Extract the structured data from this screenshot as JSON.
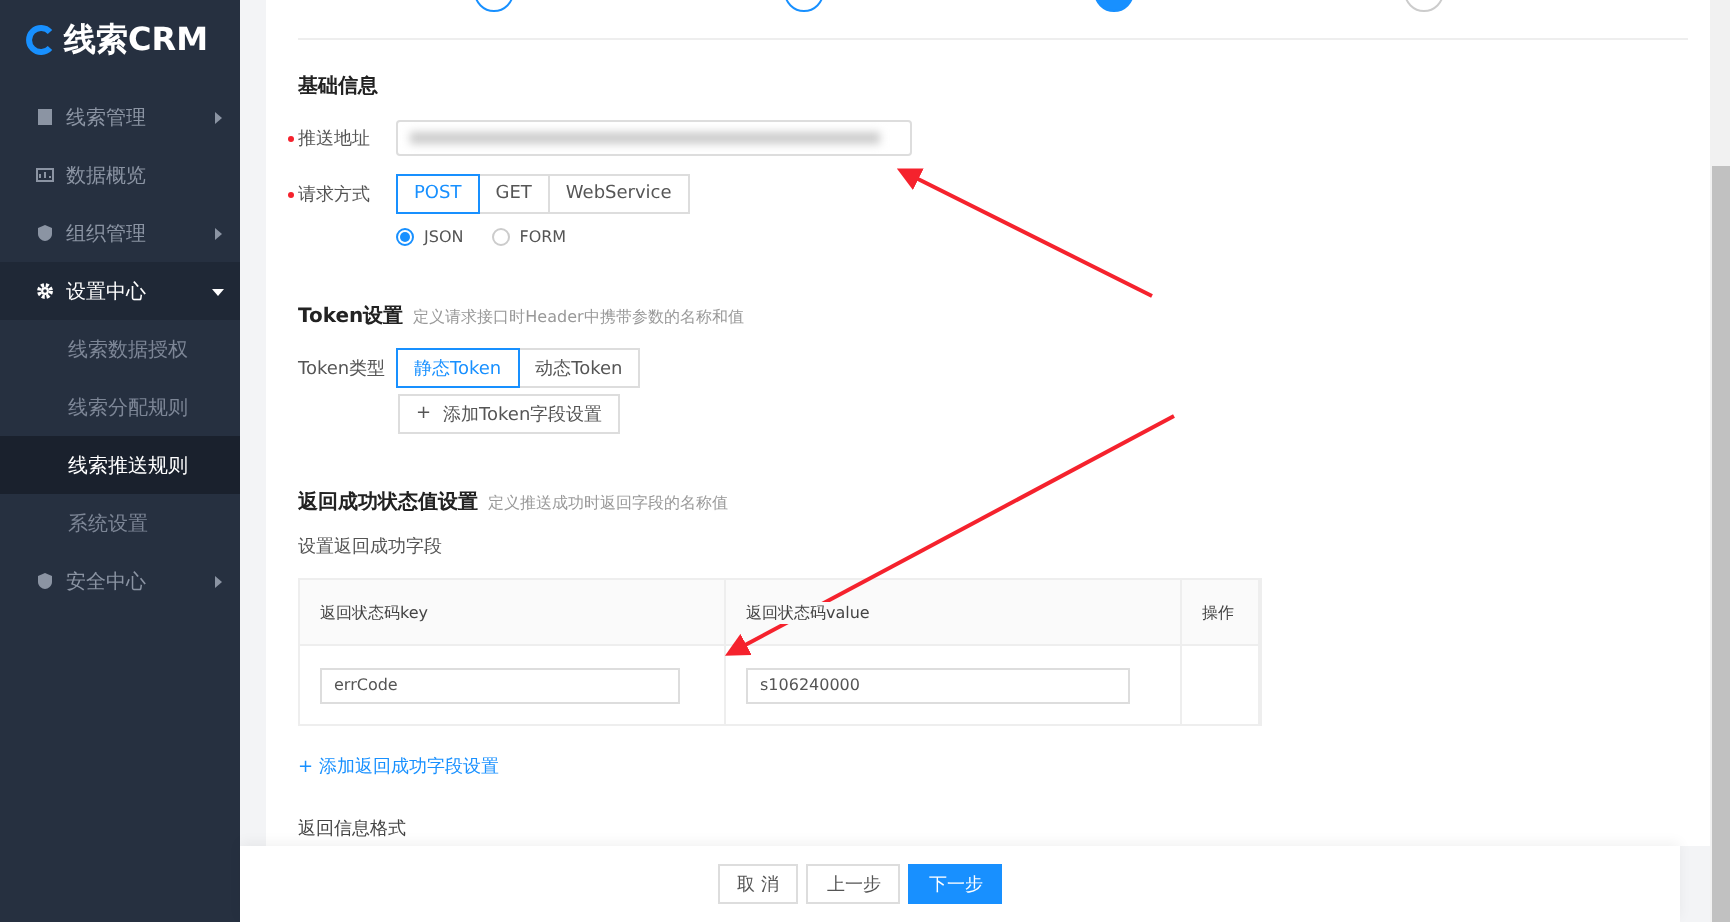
{
  "logo": {
    "text": "线索CRM"
  },
  "sidebar": {
    "items": [
      {
        "label": "线索管理",
        "has_submenu": true,
        "expanded": false
      },
      {
        "label": "数据概览",
        "has_submenu": false,
        "expanded": false
      },
      {
        "label": "组织管理",
        "has_submenu": true,
        "expanded": false
      },
      {
        "label": "设置中心",
        "has_submenu": true,
        "expanded": true,
        "children": [
          {
            "label": "线索数据授权",
            "selected": false
          },
          {
            "label": "线索分配规则",
            "selected": false
          },
          {
            "label": "线索推送规则",
            "selected": true
          },
          {
            "label": "系统设置",
            "selected": false
          }
        ]
      },
      {
        "label": "安全中心",
        "has_submenu": true,
        "expanded": false
      }
    ]
  },
  "steps": [
    {
      "completed": true,
      "selected": false
    },
    {
      "completed": true,
      "selected": false
    },
    {
      "selected": true
    },
    {
      "completed": false,
      "selected": false
    }
  ],
  "basic": {
    "title": "基础信息",
    "url_field": {
      "label": "推送地址",
      "required": true,
      "redacted": true
    },
    "method": {
      "label": "请求方式",
      "required": true,
      "options": [
        {
          "label": "POST",
          "selected": true
        },
        {
          "label": "GET",
          "selected": false
        },
        {
          "label": "WebService",
          "selected": false
        }
      ]
    },
    "format": [
      {
        "label": "JSON",
        "selected": true
      },
      {
        "label": "FORM",
        "selected": false
      }
    ]
  },
  "token": {
    "title": "Token设置",
    "hint": "定义请求接口时Header中携带参数的名称和值",
    "type_label": "Token类型",
    "options": [
      {
        "label": "静态Token",
        "selected": true
      },
      {
        "label": "动态Token",
        "selected": false
      }
    ],
    "add_button": {
      "icon": "+",
      "label": "添加Token字段设置"
    }
  },
  "success": {
    "title": "返回成功状态值设置",
    "hint": "定义推送成功时返回字段的名称值",
    "subtitle": "设置返回成功字段",
    "table": {
      "columns": [
        "返回状态码key",
        "返回状态码value",
        "操作"
      ],
      "rows": [
        {
          "key": "errCode",
          "value": "s106240000"
        }
      ]
    },
    "add_link": "添加返回成功字段设置"
  },
  "next_section": {
    "title": "返回信息格式"
  },
  "footer": {
    "buttons": [
      {
        "label": "取 消",
        "kind": "default"
      },
      {
        "label": "上一步",
        "kind": "default"
      },
      {
        "label": "下一步",
        "kind": "primary"
      }
    ]
  },
  "annotations": [
    {
      "kind": "arrow"
    },
    {
      "kind": "arrow"
    }
  ]
}
